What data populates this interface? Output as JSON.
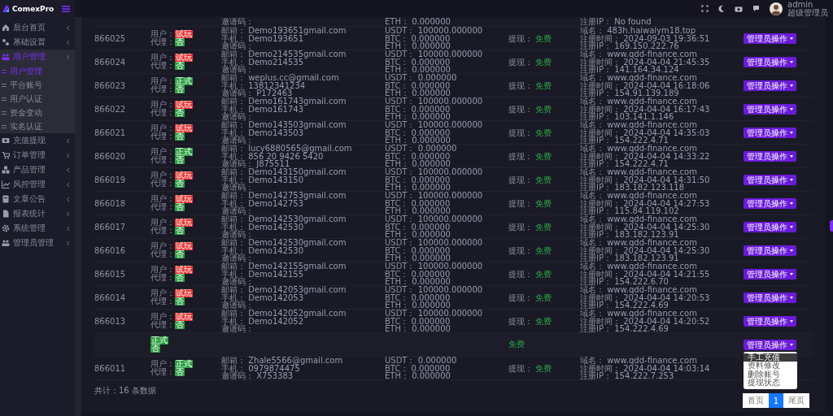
{
  "brand": "ComexPro",
  "user": {
    "name": "admin",
    "role": "超级管理员"
  },
  "sidebar": {
    "items": [
      {
        "label": "后台首页",
        "expanded": false
      },
      {
        "label": "基础设置",
        "expanded": false
      },
      {
        "label": "用户管理",
        "expanded": true,
        "children": [
          {
            "label": "用户管理",
            "selected": true
          },
          {
            "label": "平台账号",
            "selected": false
          },
          {
            "label": "用户认证",
            "selected": false
          },
          {
            "label": "资金变动",
            "selected": false
          },
          {
            "label": "实名认证",
            "selected": false
          }
        ]
      },
      {
        "label": "充值提现",
        "expanded": false
      },
      {
        "label": "订单管理",
        "expanded": false
      },
      {
        "label": "产品管理",
        "expanded": false
      },
      {
        "label": "风控管理",
        "expanded": false
      },
      {
        "label": "文章公告",
        "expanded": false
      },
      {
        "label": "报表统计",
        "expanded": false
      },
      {
        "label": "系统管理",
        "expanded": false
      },
      {
        "label": "管理员管理",
        "expanded": false
      }
    ]
  },
  "table": {
    "rows": [
      {
        "partial": true,
        "contact": [
          [
            "邀请码："
          ]
        ],
        "balance": [
          [
            "ETH：",
            "0.000000"
          ]
        ],
        "reg": [
          [
            "注册IP：",
            "No found"
          ]
        ]
      },
      {
        "id": "866025",
        "status": [
          {
            "label": "用户：",
            "value": "试玩",
            "color": "#e53935"
          },
          {
            "label": "代理：",
            "value": "否",
            "color": "#2ea043"
          }
        ],
        "contact": [
          [
            "邮箱：",
            "Demo193651gmail.com"
          ],
          [
            "手机：",
            "Demo193651"
          ],
          [
            "邀请码："
          ]
        ],
        "balance": [
          [
            "USDT：",
            "100000.000000"
          ],
          [
            "BTC：",
            "0.000000"
          ],
          [
            "ETH：",
            "0.000000"
          ]
        ],
        "withdraw": [
          "提现：",
          "免费"
        ],
        "reg": [
          [
            "域名：",
            "483h.haiwaiym18.top"
          ],
          [
            "注册时间：",
            "2024-09-03 19:36:51"
          ],
          [
            "注册IP：",
            "169.150.222.76"
          ]
        ],
        "action": "管理员操作"
      },
      {
        "id": "866024",
        "status": [
          {
            "label": "用户：",
            "value": "试玩",
            "color": "#e53935"
          },
          {
            "label": "代理：",
            "value": "否",
            "color": "#2ea043"
          }
        ],
        "contact": [
          [
            "邮箱：",
            "Demo214535gmail.com"
          ],
          [
            "手机：",
            "Demo214535"
          ],
          [
            "邀请码："
          ]
        ],
        "balance": [
          [
            "USDT：",
            "100000.000000"
          ],
          [
            "BTC：",
            "0.000000"
          ],
          [
            "ETH：",
            "0.000000"
          ]
        ],
        "withdraw": [
          "提现：",
          "免费"
        ],
        "reg": [
          [
            "域名：",
            "www.qdd-finance.com"
          ],
          [
            "注册时间：",
            "2024-04-04 21:45:35"
          ],
          [
            "注册IP：",
            "141.164.34.124"
          ]
        ],
        "action": "管理员操作"
      },
      {
        "id": "866023",
        "status": [
          {
            "label": "用户：",
            "value": "正式",
            "color": "#2ea043"
          },
          {
            "label": "代理：",
            "value": "否",
            "color": "#2ea043"
          }
        ],
        "contact": [
          [
            "邮箱：",
            "weplus.cc@gmail.com"
          ],
          [
            "手机：",
            "13812341234"
          ],
          [
            "邀请码：",
            "P172463"
          ]
        ],
        "balance": [
          [
            "USDT：",
            "0.000000"
          ],
          [
            "BTC：",
            "0.000000"
          ],
          [
            "ETH：",
            "0.000000"
          ]
        ],
        "withdraw": [
          "提现：",
          "免费"
        ],
        "reg": [
          [
            "域名：",
            "www.qdd-finance.com"
          ],
          [
            "注册时间：",
            "2024-04-04 16:18:06"
          ],
          [
            "注册IP：",
            "154.91.139.189"
          ]
        ],
        "action": "管理员操作"
      },
      {
        "id": "866022",
        "status": [
          {
            "label": "用户：",
            "value": "试玩",
            "color": "#e53935"
          },
          {
            "label": "代理：",
            "value": "否",
            "color": "#2ea043"
          }
        ],
        "contact": [
          [
            "邮箱：",
            "Demo161743gmail.com"
          ],
          [
            "手机：",
            "Demo161743"
          ],
          [
            "邀请码："
          ]
        ],
        "balance": [
          [
            "USDT：",
            "100000.000000"
          ],
          [
            "BTC：",
            "0.000000"
          ],
          [
            "ETH：",
            "0.000000"
          ]
        ],
        "withdraw": [
          "提现：",
          "免费"
        ],
        "reg": [
          [
            "域名：",
            "www.qdd-finance.com"
          ],
          [
            "注册时间：",
            "2024-04-04 16:17:43"
          ],
          [
            "注册IP：",
            "103.141.1.146"
          ]
        ],
        "action": "管理员操作"
      },
      {
        "id": "866021",
        "status": [
          {
            "label": "用户：",
            "value": "试玩",
            "color": "#e53935"
          },
          {
            "label": "代理：",
            "value": "否",
            "color": "#2ea043"
          }
        ],
        "contact": [
          [
            "邮箱：",
            "Demo143503gmail.com"
          ],
          [
            "手机：",
            "Demo143503"
          ],
          [
            "邀请码："
          ]
        ],
        "balance": [
          [
            "USDT：",
            "100000.000000"
          ],
          [
            "BTC：",
            "0.000000"
          ],
          [
            "ETH：",
            "0.000000"
          ]
        ],
        "withdraw": [
          "提现：",
          "免费"
        ],
        "reg": [
          [
            "域名：",
            "www.qdd-finance.com"
          ],
          [
            "注册时间：",
            "2024-04-04 14:35:03"
          ],
          [
            "注册IP：",
            "154.222.4.71"
          ]
        ],
        "action": "管理员操作"
      },
      {
        "id": "866020",
        "status": [
          {
            "label": "用户：",
            "value": "正式",
            "color": "#2ea043"
          },
          {
            "label": "代理：",
            "value": "否",
            "color": "#2ea043"
          }
        ],
        "contact": [
          [
            "邮箱：",
            "lucy6880565@gmail.com"
          ],
          [
            "手机：",
            "856 20 9426 5420"
          ],
          [
            "邀请码：",
            "J875511"
          ]
        ],
        "balance": [
          [
            "USDT：",
            "0.000000"
          ],
          [
            "BTC：",
            "0.000000"
          ],
          [
            "ETH：",
            "0.000000"
          ]
        ],
        "withdraw": [
          "提现：",
          "免费"
        ],
        "reg": [
          [
            "域名：",
            "www.qdd-finance.com"
          ],
          [
            "注册时间：",
            "2024-04-04 14:33:22"
          ],
          [
            "注册IP：",
            "154.222.4.71"
          ]
        ],
        "action": "管理员操作"
      },
      {
        "id": "866019",
        "status": [
          {
            "label": "用户：",
            "value": "试玩",
            "color": "#e53935"
          },
          {
            "label": "代理：",
            "value": "否",
            "color": "#2ea043"
          }
        ],
        "contact": [
          [
            "邮箱：",
            "Demo143150gmail.com"
          ],
          [
            "手机：",
            "Demo143150"
          ],
          [
            "邀请码："
          ]
        ],
        "balance": [
          [
            "USDT：",
            "100000.000000"
          ],
          [
            "BTC：",
            "0.000000"
          ],
          [
            "ETH：",
            "0.000000"
          ]
        ],
        "withdraw": [
          "提现：",
          "免费"
        ],
        "reg": [
          [
            "域名：",
            "www.qdd-finance.com"
          ],
          [
            "注册时间：",
            "2024-04-04 14:31:50"
          ],
          [
            "注册IP：",
            "183.182.123.118"
          ]
        ],
        "action": "管理员操作"
      },
      {
        "id": "866018",
        "status": [
          {
            "label": "用户：",
            "value": "试玩",
            "color": "#e53935"
          },
          {
            "label": "代理：",
            "value": "否",
            "color": "#2ea043"
          }
        ],
        "contact": [
          [
            "邮箱：",
            "Demo142753gmail.com"
          ],
          [
            "手机：",
            "Demo142753"
          ],
          [
            "邀请码："
          ]
        ],
        "balance": [
          [
            "USDT：",
            "100000.000000"
          ],
          [
            "BTC：",
            "0.000000"
          ],
          [
            "ETH：",
            "0.000000"
          ]
        ],
        "withdraw": [
          "提现：",
          "免费"
        ],
        "reg": [
          [
            "域名：",
            "www.qdd-finance.com"
          ],
          [
            "注册时间：",
            "2024-04-04 14:27:53"
          ],
          [
            "注册IP：",
            "115.84.119.102"
          ]
        ],
        "action": "管理员操作"
      },
      {
        "id": "866017",
        "status": [
          {
            "label": "用户：",
            "value": "试玩",
            "color": "#e53935"
          },
          {
            "label": "代理：",
            "value": "否",
            "color": "#2ea043"
          }
        ],
        "contact": [
          [
            "邮箱：",
            "Demo142530gmail.com"
          ],
          [
            "手机：",
            "Demo142530"
          ],
          [
            "邀请码："
          ]
        ],
        "balance": [
          [
            "USDT：",
            "100000.000000"
          ],
          [
            "BTC：",
            "0.000000"
          ],
          [
            "ETH：",
            "0.000000"
          ]
        ],
        "withdraw": [
          "提现：",
          "免费"
        ],
        "reg": [
          [
            "域名：",
            "www.qdd-finance.com"
          ],
          [
            "注册时间：",
            "2024-04-04 14:25:30"
          ],
          [
            "注册IP：",
            "183.182.123.91"
          ]
        ],
        "action": "管理员操作"
      },
      {
        "id": "866016",
        "status": [
          {
            "label": "用户：",
            "value": "试玩",
            "color": "#e53935"
          },
          {
            "label": "代理：",
            "value": "否",
            "color": "#2ea043"
          }
        ],
        "contact": [
          [
            "邮箱：",
            "Demo142530gmail.com"
          ],
          [
            "手机：",
            "Demo142530"
          ],
          [
            "邀请码："
          ]
        ],
        "balance": [
          [
            "USDT：",
            "100000.000000"
          ],
          [
            "BTC：",
            "0.000000"
          ],
          [
            "ETH：",
            "0.000000"
          ]
        ],
        "withdraw": [
          "提现：",
          "免费"
        ],
        "reg": [
          [
            "域名：",
            "www.qdd-finance.com"
          ],
          [
            "注册时间：",
            "2024-04-04 14:25:30"
          ],
          [
            "注册IP：",
            "183.182.123.91"
          ]
        ],
        "action": "管理员操作"
      },
      {
        "id": "866015",
        "status": [
          {
            "label": "用户：",
            "value": "试玩",
            "color": "#e53935"
          },
          {
            "label": "代理：",
            "value": "否",
            "color": "#2ea043"
          }
        ],
        "contact": [
          [
            "邮箱：",
            "Demo142155gmail.com"
          ],
          [
            "手机：",
            "Demo142155"
          ],
          [
            "邀请码："
          ]
        ],
        "balance": [
          [
            "USDT：",
            "100000.000000"
          ],
          [
            "BTC：",
            "0.000000"
          ],
          [
            "ETH：",
            "0.000000"
          ]
        ],
        "withdraw": [
          "提现：",
          "免费"
        ],
        "reg": [
          [
            "域名：",
            "www.qdd-finance.com"
          ],
          [
            "注册时间：",
            "2024-04-04 14:21:55"
          ],
          [
            "注册IP：",
            "154.222.6.70"
          ]
        ],
        "action": "管理员操作"
      },
      {
        "id": "866014",
        "status": [
          {
            "label": "用户：",
            "value": "试玩",
            "color": "#e53935"
          },
          {
            "label": "代理：",
            "value": "否",
            "color": "#2ea043"
          }
        ],
        "contact": [
          [
            "邮箱：",
            "Demo142053gmail.com"
          ],
          [
            "手机：",
            "Demo142053"
          ],
          [
            "邀请码："
          ]
        ],
        "balance": [
          [
            "USDT：",
            "100000.000000"
          ],
          [
            "BTC：",
            "0.000000"
          ],
          [
            "ETH：",
            "0.000000"
          ]
        ],
        "withdraw": [
          "提现：",
          "免费"
        ],
        "reg": [
          [
            "域名：",
            "www.qdd-finance.com"
          ],
          [
            "注册时间：",
            "2024-04-04 14:20:53"
          ],
          [
            "注册IP：",
            "154.222.4.69"
          ]
        ],
        "action": "管理员操作"
      },
      {
        "id": "866013",
        "status": [
          {
            "label": "用户：",
            "value": "试玩",
            "color": "#e53935"
          },
          {
            "label": "代理：",
            "value": "否",
            "color": "#2ea043"
          }
        ],
        "contact": [
          [
            "邮箱：",
            "Demo142052gmail.com"
          ],
          [
            "手机：",
            "Demo142052"
          ],
          [
            "邀请码："
          ]
        ],
        "balance": [
          [
            "USDT：",
            "100000.000000"
          ],
          [
            "BTC：",
            "0.000000"
          ],
          [
            "ETH：",
            "0.000000"
          ]
        ],
        "withdraw": [
          "提现：",
          "免费"
        ],
        "reg": [
          [
            "域名：",
            "www.qdd-finance.com"
          ],
          [
            "注册时间：",
            "2024-04-04 14:20:52"
          ],
          [
            "注册IP：",
            "154.222.4.69"
          ]
        ],
        "action": "管理员操作"
      },
      {
        "dimmed": true,
        "status": [
          {
            "value": "正式",
            "color": "#2ea043"
          },
          {
            "value": "否",
            "color": "#2ea043"
          }
        ],
        "withdraw": {
          "value": "免费"
        },
        "action": "管理员操作",
        "menu": [
          {
            "label": "手工充值",
            "selected": true
          },
          {
            "label": "资料修改",
            "selected": false
          },
          {
            "label": "删除账号",
            "selected": false
          },
          {
            "label": "提现状态",
            "selected": false
          }
        ]
      },
      {
        "id": "866011",
        "status": [
          {
            "label": "用户：",
            "value": "正式",
            "color": "#2ea043"
          },
          {
            "label": "代理：",
            "value": "否",
            "color": "#2ea043"
          }
        ],
        "contact": [
          [
            "邮箱：",
            "Zhale5566@gmail.com"
          ],
          [
            "手机：",
            "0979874475"
          ],
          [
            "邀请码：",
            "X753383"
          ]
        ],
        "balance": [
          [
            "USDT：",
            "0.000000"
          ],
          [
            "BTC：",
            "0.000000"
          ],
          [
            "ETH：",
            "0.000000"
          ]
        ],
        "withdraw": [
          "提现：",
          "免费"
        ],
        "reg": [
          [
            "域名：",
            "www.qdd-finance.com"
          ],
          [
            "注册时间：",
            "2024-04-04 14:03:14"
          ],
          [
            "注册IP：",
            "154.222.7.253"
          ]
        ]
      }
    ],
    "total": "共计：16 条数据"
  },
  "pagination": [
    {
      "label": "首页",
      "selected": false
    },
    {
      "label": "1",
      "selected": true
    },
    {
      "label": "尾页",
      "selected": false
    }
  ]
}
